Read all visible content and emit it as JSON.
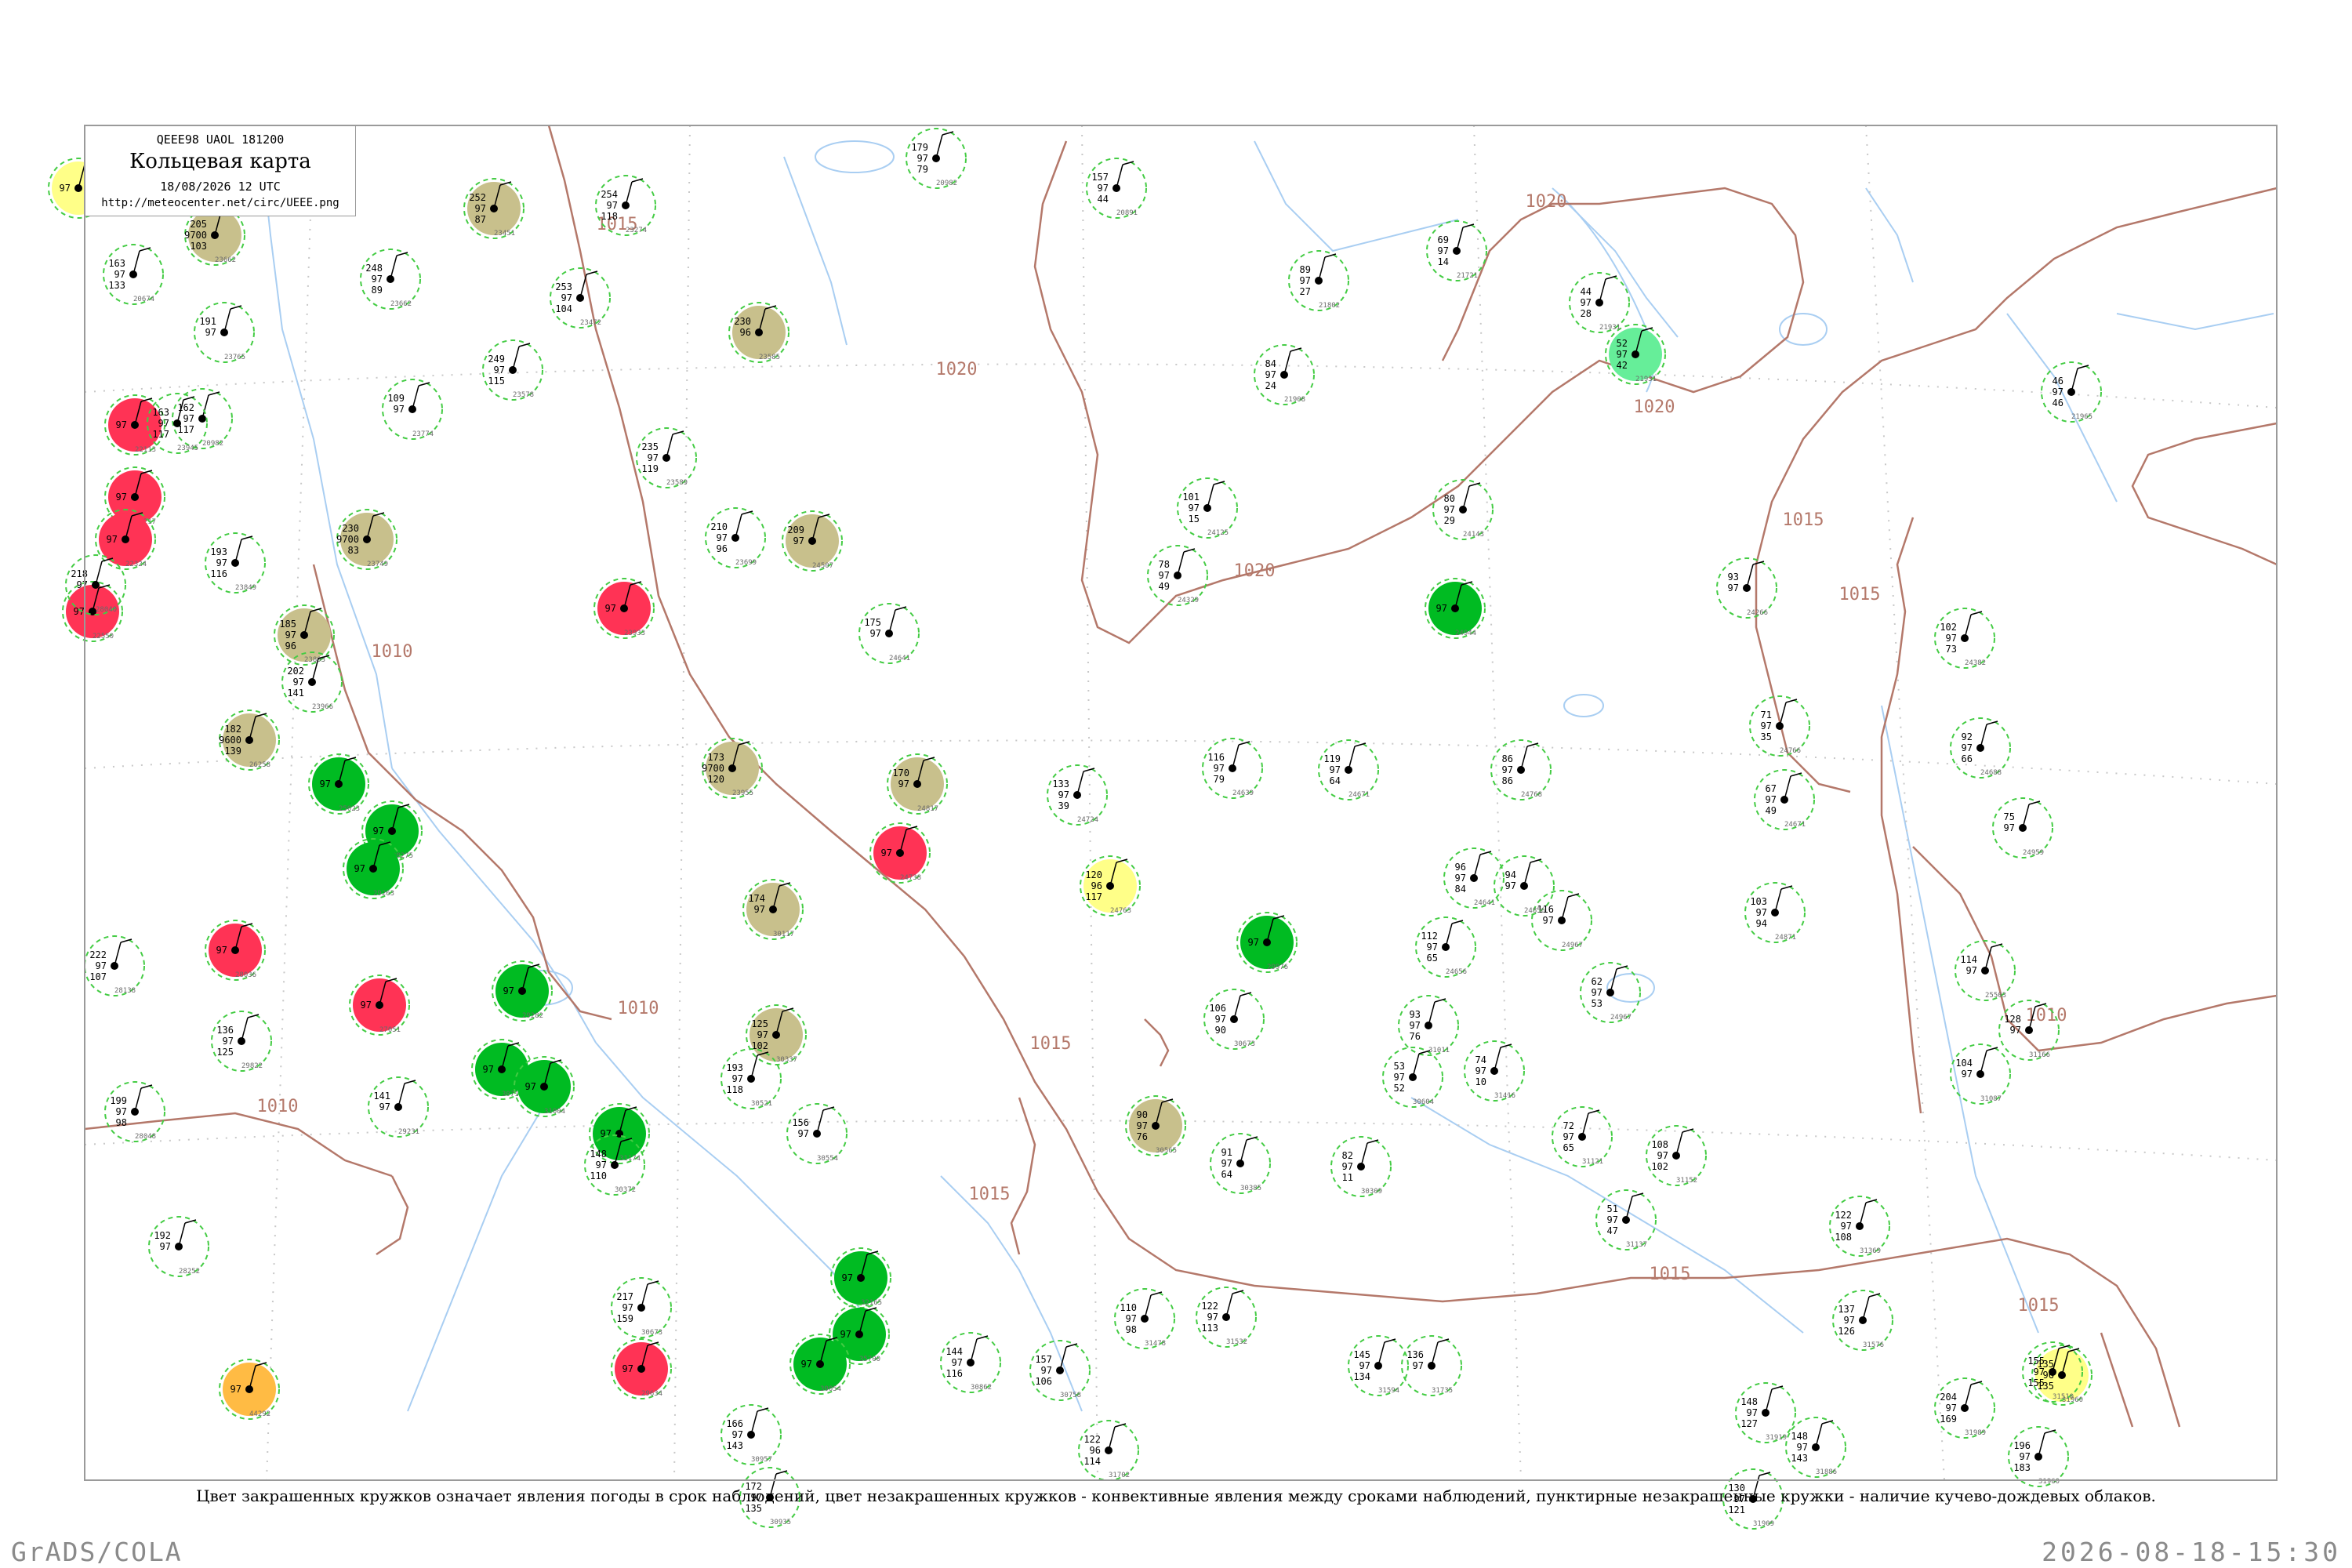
{
  "header": {
    "code": "QEEE98  UAOL  181200",
    "title": "Кольцевая карта",
    "date": "18/08/2026 12 UTC",
    "url": "http://meteocenter.net/circ/UEEE.png"
  },
  "legend_text": "Цвет закрашенных кружков означает явления погоды в срок наблюдений, цвет незакрашенных кружков - конвективные явления между сроками наблюдений, пунктирные незакрашенные кружки - наличие кучево-дождевых облаков.",
  "footer": {
    "software": "GrADS/COLA",
    "timestamp": "2026-08-18-15:30"
  },
  "colors": {
    "frame": "#9a9a9a",
    "rivers": "#a9cef2",
    "isobars": "#b4786a",
    "isobar_labels": "#b4786a",
    "convective_dashed": "#44cc44",
    "thunderstorm": "#00bb22",
    "rain_shower": "#ff3355",
    "fog_haze": "#c8c08c",
    "drizzle": "#ffff88",
    "dust": "#ffbb44",
    "showers_light": "#66ee99"
  },
  "isobar_labels": [
    "1020",
    "1020",
    "1020",
    "1020",
    "1015",
    "1015",
    "1015",
    "1015",
    "1015",
    "1015",
    "1015",
    "1010",
    "1010",
    "1010",
    "1010"
  ],
  "stations": [
    {
      "temp": "205",
      "press": "9700",
      "dew": "103",
      "id": "23662",
      "phen": "fog_haze"
    },
    {
      "temp": "252",
      "press": "97",
      "dew": "87",
      "id": "23451",
      "phen": "fog_haze"
    },
    {
      "temp": "230",
      "press": "96",
      "dew": "",
      "id": "23585",
      "phen": "fog_haze"
    },
    {
      "temp": "209",
      "press": "97",
      "dew": "",
      "id": "24507",
      "phen": "fog_haze"
    },
    {
      "temp": "230",
      "press": "9700",
      "dew": "83",
      "id": "23749",
      "phen": "fog_haze"
    },
    {
      "temp": "185",
      "press": "97",
      "dew": "96",
      "id": "23803",
      "phen": "fog_haze"
    },
    {
      "temp": "173",
      "press": "9700",
      "dew": "120",
      "id": "23955",
      "phen": "fog_haze"
    },
    {
      "temp": "170",
      "press": "97",
      "dew": "",
      "id": "24817",
      "phen": "fog_haze"
    },
    {
      "temp": "174",
      "press": "97",
      "dew": "",
      "id": "30117",
      "phen": "fog_haze"
    },
    {
      "temp": "125",
      "press": "97",
      "dew": "102",
      "id": "30337",
      "phen": "fog_haze"
    },
    {
      "temp": "90",
      "press": "97",
      "dew": "76",
      "id": "30565",
      "phen": "fog_haze"
    },
    {
      "temp": "182",
      "press": "9600",
      "dew": "139",
      "id": "26258",
      "phen": "fog_haze"
    },
    {
      "temp": "",
      "press": "97",
      "dew": "",
      "id": "22113",
      "phen": "rain_shower"
    },
    {
      "temp": "",
      "press": "97",
      "dew": "",
      "id": "22217",
      "phen": "rain_shower"
    },
    {
      "temp": "",
      "press": "97",
      "dew": "",
      "id": "22324",
      "phen": "rain_shower"
    },
    {
      "temp": "",
      "press": "97",
      "dew": "",
      "id": "22550",
      "phen": "rain_shower"
    },
    {
      "temp": "",
      "press": "97",
      "dew": "",
      "id": "23933",
      "phen": "rain_shower"
    },
    {
      "temp": "",
      "press": "97",
      "dew": "",
      "id": "24738",
      "phen": "rain_shower"
    },
    {
      "temp": "",
      "press": "97",
      "dew": "",
      "id": "27051",
      "phen": "rain_shower"
    },
    {
      "temp": "",
      "press": "97",
      "dew": "",
      "id": "28036",
      "phen": "rain_shower"
    },
    {
      "temp": "",
      "press": "97",
      "dew": "",
      "id": "29634",
      "phen": "rain_shower"
    },
    {
      "temp": "",
      "press": "97",
      "dew": "",
      "id": "25023",
      "phen": "thunderstorm"
    },
    {
      "temp": "",
      "press": "97",
      "dew": "",
      "id": "28275",
      "phen": "thunderstorm"
    },
    {
      "temp": "",
      "press": "97",
      "dew": "",
      "id": "29263",
      "phen": "thunderstorm"
    },
    {
      "temp": "",
      "press": "97",
      "dew": "",
      "id": "29282",
      "phen": "thunderstorm"
    },
    {
      "temp": "",
      "press": "97",
      "dew": "",
      "id": "30710",
      "phen": "thunderstorm"
    },
    {
      "temp": "",
      "press": "97",
      "dew": "",
      "id": "31004",
      "phen": "thunderstorm"
    },
    {
      "temp": "",
      "press": "97",
      "dew": "",
      "id": "31174",
      "phen": "thunderstorm"
    },
    {
      "temp": "",
      "press": "97",
      "dew": "",
      "id": "32165",
      "phen": "thunderstorm"
    },
    {
      "temp": "",
      "press": "97",
      "dew": "",
      "id": "35700",
      "phen": "thunderstorm"
    },
    {
      "temp": "",
      "press": "97",
      "dew": "",
      "id": "24944",
      "phen": "thunderstorm"
    },
    {
      "temp": "",
      "press": "97",
      "dew": "",
      "id": "29976",
      "phen": "thunderstorm"
    },
    {
      "temp": "",
      "press": "97",
      "dew": "",
      "id": "30054",
      "phen": "thunderstorm"
    },
    {
      "temp": "52",
      "press": "97",
      "dew": "42",
      "id": "21931",
      "phen": "showers_light"
    },
    {
      "temp": "120",
      "press": "96",
      "dew": "117",
      "id": "24763",
      "phen": "drizzle"
    },
    {
      "temp": "135",
      "press": "96",
      "dew": "135",
      "id": "31960",
      "phen": "drizzle"
    },
    {
      "temp": "",
      "press": "97",
      "dew": "",
      "id": "44292",
      "phen": "dust"
    },
    {
      "temp": "",
      "press": "97",
      "dew": "",
      "id": "",
      "phen": "drizzle"
    },
    {
      "temp": "163",
      "press": "97",
      "dew": "133",
      "id": "20674",
      "phen": "none"
    },
    {
      "temp": "162",
      "press": "97",
      "dew": "117",
      "id": "20982",
      "phen": "none"
    },
    {
      "temp": "249",
      "press": "97",
      "dew": "115",
      "id": "23578",
      "phen": "none"
    },
    {
      "temp": "235",
      "press": "97",
      "dew": "119",
      "id": "23589",
      "phen": "none"
    },
    {
      "temp": "210",
      "press": "97",
      "dew": "96",
      "id": "23699",
      "phen": "none"
    },
    {
      "temp": "175",
      "press": "97",
      "dew": "",
      "id": "24641",
      "phen": "none"
    },
    {
      "temp": "133",
      "press": "97",
      "dew": "39",
      "id": "24724",
      "phen": "none"
    },
    {
      "temp": "116",
      "press": "97",
      "dew": "79",
      "id": "24639",
      "phen": "none"
    },
    {
      "temp": "119",
      "press": "97",
      "dew": "64",
      "id": "24671",
      "phen": "none"
    },
    {
      "temp": "86",
      "press": "97",
      "dew": "86",
      "id": "24768",
      "phen": "none"
    },
    {
      "temp": "44",
      "press": "97",
      "dew": "28",
      "id": "21931",
      "phen": "none"
    },
    {
      "temp": "69",
      "press": "97",
      "dew": "14",
      "id": "21721",
      "phen": "none"
    },
    {
      "temp": "46",
      "press": "97",
      "dew": "46",
      "id": "21965",
      "phen": "none"
    },
    {
      "temp": "93",
      "press": "97",
      "dew": "",
      "id": "24266",
      "phen": "none"
    },
    {
      "temp": "102",
      "press": "97",
      "dew": "73",
      "id": "24382",
      "phen": "none"
    },
    {
      "temp": "71",
      "press": "97",
      "dew": "35",
      "id": "24766",
      "phen": "none"
    },
    {
      "temp": "67",
      "press": "97",
      "dew": "49",
      "id": "24671",
      "phen": "none"
    },
    {
      "temp": "92",
      "press": "97",
      "dew": "66",
      "id": "24688",
      "phen": "none"
    },
    {
      "temp": "75",
      "press": "97",
      "dew": "",
      "id": "24959",
      "phen": "none"
    },
    {
      "temp": "114",
      "press": "97",
      "dew": "",
      "id": "25503",
      "phen": "none"
    },
    {
      "temp": "128",
      "press": "97",
      "dew": "",
      "id": "31166",
      "phen": "none"
    },
    {
      "temp": "104",
      "press": "97",
      "dew": "",
      "id": "31087",
      "phen": "none"
    },
    {
      "temp": "122",
      "press": "97",
      "dew": "108",
      "id": "31369",
      "phen": "none"
    },
    {
      "temp": "137",
      "press": "97",
      "dew": "126",
      "id": "31576",
      "phen": "none"
    },
    {
      "temp": "204",
      "press": "97",
      "dew": "169",
      "id": "31989",
      "phen": "none"
    },
    {
      "temp": "196",
      "press": "97",
      "dew": "183",
      "id": "31960",
      "phen": "none"
    },
    {
      "temp": "155",
      "press": "97",
      "dew": "155",
      "id": "31510",
      "phen": "none"
    },
    {
      "temp": "148",
      "press": "97",
      "dew": "127",
      "id": "31919",
      "phen": "none"
    },
    {
      "temp": "148",
      "press": "97",
      "dew": "143",
      "id": "31886",
      "phen": "none"
    },
    {
      "temp": "130",
      "press": "97",
      "dew": "121",
      "id": "31909",
      "phen": "none"
    },
    {
      "temp": "110",
      "press": "97",
      "dew": "98",
      "id": "31478",
      "phen": "none"
    },
    {
      "temp": "122",
      "press": "97",
      "dew": "113",
      "id": "31532",
      "phen": "none"
    },
    {
      "temp": "145",
      "press": "97",
      "dew": "134",
      "id": "31594",
      "phen": "none"
    },
    {
      "temp": "136",
      "press": "97",
      "dew": "",
      "id": "31735",
      "phen": "none"
    },
    {
      "temp": "122",
      "press": "96",
      "dew": "114",
      "id": "31702",
      "phen": "none"
    },
    {
      "temp": "144",
      "press": "97",
      "dew": "116",
      "id": "30862",
      "phen": "none"
    },
    {
      "temp": "157",
      "press": "97",
      "dew": "106",
      "id": "30758",
      "phen": "none"
    },
    {
      "temp": "166",
      "press": "97",
      "dew": "143",
      "id": "30957",
      "phen": "none"
    },
    {
      "temp": "172",
      "press": "97",
      "dew": "135",
      "id": "30935",
      "phen": "none"
    },
    {
      "temp": "156",
      "press": "97",
      "dew": "",
      "id": "30554",
      "phen": "none"
    },
    {
      "temp": "193",
      "press": "97",
      "dew": "118",
      "id": "30521",
      "phen": "none"
    },
    {
      "temp": "217",
      "press": "97",
      "dew": "159",
      "id": "30673",
      "phen": "none"
    },
    {
      "temp": "148",
      "press": "97",
      "dew": "110",
      "id": "30372",
      "phen": "none"
    },
    {
      "temp": "141",
      "press": "97",
      "dew": "",
      "id": "29231",
      "phen": "none"
    },
    {
      "temp": "199",
      "press": "97",
      "dew": "98",
      "id": "28048",
      "phen": "none"
    },
    {
      "temp": "192",
      "press": "97",
      "dew": "",
      "id": "28252",
      "phen": "none"
    },
    {
      "temp": "222",
      "press": "97",
      "dew": "107",
      "id": "28138",
      "phen": "none"
    },
    {
      "temp": "136",
      "press": "97",
      "dew": "125",
      "id": "29822",
      "phen": "none"
    },
    {
      "temp": "106",
      "press": "97",
      "dew": "90",
      "id": "30673",
      "phen": "none"
    },
    {
      "temp": "93",
      "press": "97",
      "dew": "76",
      "id": "31011",
      "phen": "none"
    },
    {
      "temp": "74",
      "press": "97",
      "dew": "10",
      "id": "31416",
      "phen": "none"
    },
    {
      "temp": "53",
      "press": "97",
      "dew": "52",
      "id": "30604",
      "phen": "none"
    },
    {
      "temp": "91",
      "press": "97",
      "dew": "64",
      "id": "30385",
      "phen": "none"
    },
    {
      "temp": "82",
      "press": "97",
      "dew": "11",
      "id": "30309",
      "phen": "none"
    },
    {
      "temp": "72",
      "press": "97",
      "dew": "65",
      "id": "31121",
      "phen": "none"
    },
    {
      "temp": "51",
      "press": "97",
      "dew": "47",
      "id": "31137",
      "phen": "none"
    },
    {
      "temp": "108",
      "press": "97",
      "dew": "102",
      "id": "31152",
      "phen": "none"
    },
    {
      "temp": "103",
      "press": "97",
      "dew": "94",
      "id": "24871",
      "phen": "none"
    },
    {
      "temp": "116",
      "press": "97",
      "dew": "",
      "id": "24967",
      "phen": "none"
    },
    {
      "temp": "62",
      "press": "97",
      "dew": "53",
      "id": "24967",
      "phen": "none"
    },
    {
      "temp": "112",
      "press": "97",
      "dew": "65",
      "id": "24656",
      "phen": "none"
    },
    {
      "temp": "94",
      "press": "97",
      "dew": "",
      "id": "24856",
      "phen": "none"
    },
    {
      "temp": "96",
      "press": "97",
      "dew": "84",
      "id": "24641",
      "phen": "none"
    },
    {
      "temp": "101",
      "press": "97",
      "dew": "15",
      "id": "24125",
      "phen": "none"
    },
    {
      "temp": "78",
      "press": "97",
      "dew": "49",
      "id": "24329",
      "phen": "none"
    },
    {
      "temp": "80",
      "press": "97",
      "dew": "29",
      "id": "24143",
      "phen": "none"
    },
    {
      "temp": "89",
      "press": "97",
      "dew": "27",
      "id": "21802",
      "phen": "none"
    },
    {
      "temp": "84",
      "press": "97",
      "dew": "24",
      "id": "21908",
      "phen": "none"
    },
    {
      "temp": "157",
      "press": "97",
      "dew": "44",
      "id": "20891",
      "phen": "none"
    },
    {
      "temp": "179",
      "press": "97",
      "dew": "79",
      "id": "20982",
      "phen": "none"
    },
    {
      "temp": "254",
      "press": "97",
      "dew": "118",
      "id": "23274",
      "phen": "none"
    },
    {
      "temp": "253",
      "press": "97",
      "dew": "104",
      "id": "23472",
      "phen": "none"
    },
    {
      "temp": "248",
      "press": "97",
      "dew": "89",
      "id": "23662",
      "phen": "none"
    },
    {
      "temp": "109",
      "press": "97",
      "dew": "",
      "id": "23774",
      "phen": "none"
    },
    {
      "temp": "202",
      "press": "97",
      "dew": "141",
      "id": "23966",
      "phen": "none"
    },
    {
      "temp": "193",
      "press": "97",
      "dew": "116",
      "id": "23849",
      "phen": "none"
    },
    {
      "temp": "218",
      "press": "97",
      "dew": "",
      "id": "28040",
      "phen": "none"
    },
    {
      "temp": "191",
      "press": "97",
      "dew": "",
      "id": "23765",
      "phen": "none"
    },
    {
      "temp": "163",
      "press": "97",
      "dew": "117",
      "id": "23945",
      "phen": "none"
    }
  ]
}
